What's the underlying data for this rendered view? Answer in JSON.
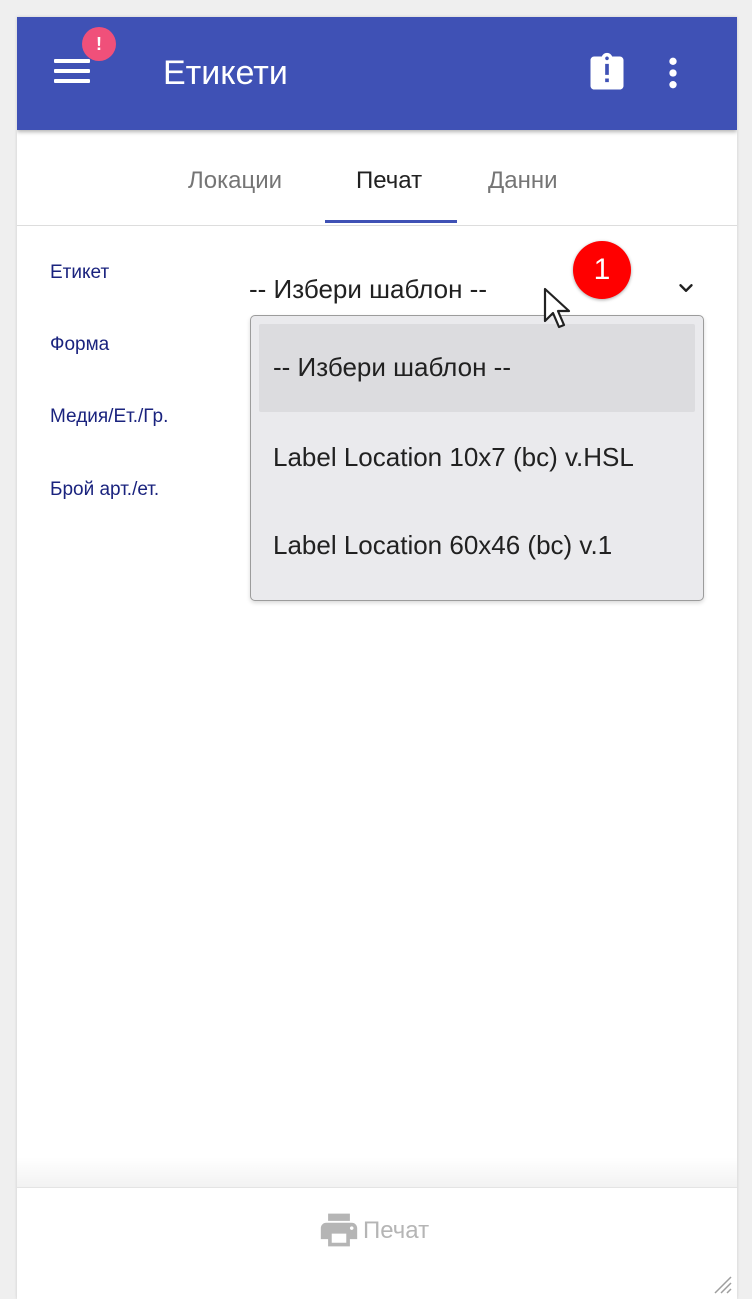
{
  "app_bar": {
    "title": "Етикети",
    "alert_badge": "!",
    "background_color": "#3f51b5"
  },
  "tabs": [
    {
      "label": "Локации",
      "active": false
    },
    {
      "label": "Печат",
      "active": true
    },
    {
      "label": "Данни",
      "active": false
    }
  ],
  "form": {
    "labels": {
      "label_template": "Етикет",
      "form": "Форма",
      "media": "Медия/Ет./Гр.",
      "items_per_label": "Брой арт./ет."
    },
    "template_select": {
      "selected": "-- Избери шаблон --",
      "options": [
        "-- Избери шаблон --",
        "Label Location 10x7 (bc) v.HSL",
        "Label Location 60x46 (bc) v.1"
      ]
    }
  },
  "annotation": {
    "step_number": "1",
    "color": "#ff0000"
  },
  "bottom_bar": {
    "print_label": "Печат"
  },
  "icons": {
    "menu": "menu-icon",
    "clipboard": "clipboard-alert-icon",
    "more": "more-vertical-icon",
    "chevron": "chevron-down-icon",
    "printer": "printer-icon",
    "cursor": "mouse-pointer-icon",
    "resize": "resize-handle-icon"
  }
}
